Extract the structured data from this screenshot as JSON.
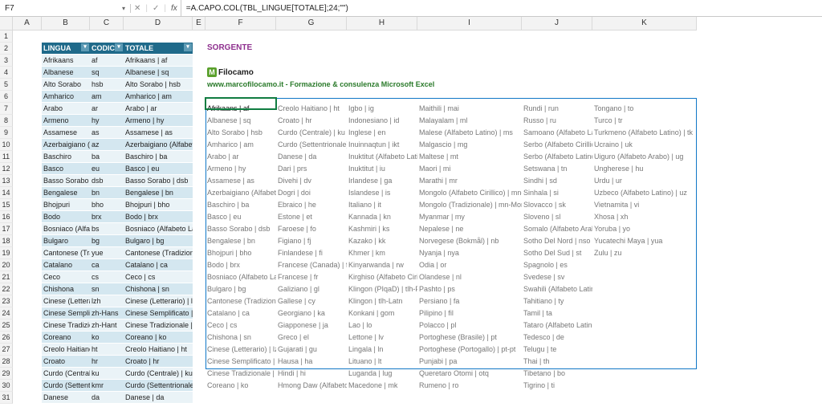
{
  "formula_bar": {
    "name_box": "F7",
    "formula": "=A.CAPO.COL(TBL_LINGUE[TOTALE];24;\"\")"
  },
  "columns": [
    "",
    "A",
    "B",
    "C",
    "D",
    "E",
    "F",
    "G",
    "H",
    "I",
    "J",
    "K"
  ],
  "rownums": [
    1,
    2,
    3,
    4,
    5,
    6,
    7,
    8,
    9,
    10,
    11,
    12,
    13,
    14,
    15,
    16,
    17,
    18,
    19,
    20,
    21,
    22,
    23,
    24,
    25,
    26,
    27,
    28,
    29,
    30,
    31
  ],
  "table": {
    "name": "TBL_LINGUE",
    "headers": {
      "lingua": "LINGUA",
      "codice": "CODICE",
      "totale": "TOTALE"
    },
    "rows": [
      {
        "l": "Afrikaans",
        "c": "af",
        "t": "Afrikaans | af"
      },
      {
        "l": "Albanese",
        "c": "sq",
        "t": "Albanese | sq"
      },
      {
        "l": "Alto Sorabo",
        "c": "hsb",
        "t": "Alto Sorabo | hsb"
      },
      {
        "l": "Amharico",
        "c": "am",
        "t": "Amharico | am"
      },
      {
        "l": "Arabo",
        "c": "ar",
        "t": "Arabo | ar"
      },
      {
        "l": "Armeno",
        "c": "hy",
        "t": "Armeno | hy"
      },
      {
        "l": "Assamese",
        "c": "as",
        "t": "Assamese | as"
      },
      {
        "l": "Azerbaigiano (Alfabeto Latino)",
        "c": "az",
        "t": "Azerbaigiano (Alfabeto Latino) | az"
      },
      {
        "l": "Baschiro",
        "c": "ba",
        "t": "Baschiro | ba"
      },
      {
        "l": "Basco",
        "c": "eu",
        "t": "Basco | eu"
      },
      {
        "l": "Basso Sorabo",
        "c": "dsb",
        "t": "Basso Sorabo | dsb"
      },
      {
        "l": "Bengalese",
        "c": "bn",
        "t": "Bengalese | bn"
      },
      {
        "l": "Bhojpuri",
        "c": "bho",
        "t": "Bhojpuri | bho"
      },
      {
        "l": "Bodo",
        "c": "brx",
        "t": "Bodo | brx"
      },
      {
        "l": "Bosniaco (Alfabeto Latino)",
        "c": "bs",
        "t": "Bosniaco (Alfabeto Latino) | bs"
      },
      {
        "l": "Bulgaro",
        "c": "bg",
        "t": "Bulgaro | bg"
      },
      {
        "l": "Cantonese (Tradizionale)",
        "c": "yue",
        "t": "Cantonese (Tradizionale) | yue"
      },
      {
        "l": "Catalano",
        "c": "ca",
        "t": "Catalano | ca"
      },
      {
        "l": "Ceco",
        "c": "cs",
        "t": "Ceco | cs"
      },
      {
        "l": "Chishona",
        "c": "sn",
        "t": "Chishona | sn"
      },
      {
        "l": "Cinese (Letterario)",
        "c": "lzh",
        "t": "Cinese (Letterario) | lzh"
      },
      {
        "l": "Cinese Semplificato",
        "c": "zh-Hans",
        "t": "Cinese Semplificato | zh-Hans"
      },
      {
        "l": "Cinese Tradizionale",
        "c": "zh-Hant",
        "t": "Cinese Tradizionale | zh-Hant"
      },
      {
        "l": "Coreano",
        "c": "ko",
        "t": "Coreano | ko"
      },
      {
        "l": "Creolo Haitiano",
        "c": "ht",
        "t": "Creolo Haitiano | ht"
      },
      {
        "l": "Croato",
        "c": "hr",
        "t": "Croato | hr"
      },
      {
        "l": "Curdo (Centrale)",
        "c": "ku",
        "t": "Curdo (Centrale) | ku"
      },
      {
        "l": "Curdo (Settentrionale)",
        "c": "kmr",
        "t": "Curdo (Settentrionale) | kmr"
      },
      {
        "l": "Danese",
        "c": "da",
        "t": "Danese | da"
      }
    ]
  },
  "right_panel": {
    "sorgente": "SORGENTE",
    "brand": "Filocamo",
    "tagline": "www.marcofilocamo.it - Formazione & consulenza Microsoft Excel"
  },
  "spill": [
    [
      "Afrikaans | af",
      "Creolo Haitiano | ht",
      "Igbo | ig",
      "Maithili | mai",
      "Rundi | run",
      "Tongano | to"
    ],
    [
      "Albanese | sq",
      "Croato | hr",
      "Indonesiano | id",
      "Malayalam | ml",
      "Russo | ru",
      "Turco | tr"
    ],
    [
      "Alto Sorabo | hsb",
      "Curdo (Centrale) | ku",
      "Inglese | en",
      "Malese (Alfabeto Latino) | ms",
      "Samoano (Alfabeto Latino) | sm",
      "Turkmeno (Alfabeto Latino) | tk"
    ],
    [
      "Amharico | am",
      "Curdo (Settentrionale) | kmr",
      "Inuinnaqtun | ikt",
      "Malgascio | mg",
      "Serbo (Alfabeto Cirillico) | sr-Cyrl",
      "Ucraino | uk"
    ],
    [
      "Arabo | ar",
      "Danese | da",
      "Inuktitut (Alfabeto Latino) | iu-Latn",
      "Maltese | mt",
      "Serbo (Alfabeto Latino) | sr-Latn",
      "Uiguro (Alfabeto Arabo) | ug"
    ],
    [
      "Armeno | hy",
      "Dari | prs",
      "Inuktitut | iu",
      "Maori | mi",
      "Setswana | tn",
      "Ungherese | hu"
    ],
    [
      "Assamese | as",
      "Divehi | dv",
      "Irlandese | ga",
      "Marathi | mr",
      "Sindhi | sd",
      "Urdu | ur"
    ],
    [
      "Azerbaigiano (Alfabeto Latino) | az",
      "Dogri | doi",
      "Islandese | is",
      "Mongolo (Alfabeto Cirillico) | mn-Cyrl",
      "Sinhala | si",
      "Uzbeco (Alfabeto Latino) | uz"
    ],
    [
      "Baschiro | ba",
      "Ebraico | he",
      "Italiano | it",
      "Mongolo (Tradizionale) | mn-Mong",
      "Slovacco | sk",
      "Vietnamita | vi"
    ],
    [
      "Basco | eu",
      "Estone | et",
      "Kannada | kn",
      "Myanmar | my",
      "Sloveno | sl",
      "Xhosa | xh"
    ],
    [
      "Basso Sorabo | dsb",
      "Faroese | fo",
      "Kashmiri | ks",
      "Nepalese | ne",
      "Somalo (Alfabeto Arabo) | so",
      "Yoruba | yo"
    ],
    [
      "Bengalese | bn",
      "Figiano | fj",
      "Kazako | kk",
      "Norvegese (Bokmål) | nb",
      "Sotho Del Nord | nso",
      "Yucatechi Maya | yua"
    ],
    [
      "Bhojpuri | bho",
      "Finlandese | fi",
      "Khmer | km",
      "Nyanja | nya",
      "Sotho Del Sud | st",
      "Zulu | zu"
    ],
    [
      "Bodo | brx",
      "Francese (Canada) | fr-ca",
      "Kinyarwanda | rw",
      "Odia | or",
      "Spagnolo | es",
      ""
    ],
    [
      "Bosniaco (Alfabeto Latino) | bs",
      "Francese | fr",
      "Kirghiso (Alfabeto Cirillico) | ky",
      "Olandese | nl",
      "Svedese | sv",
      ""
    ],
    [
      "Bulgaro | bg",
      "Galiziano | gl",
      "Klingon (PIqaD) | tlh-Piqd",
      "Pashto | ps",
      "Swahili (Alfabeto Latino) | sw",
      ""
    ],
    [
      "Cantonese (Tradizionale) | yue",
      "Gallese | cy",
      "Klingon | tlh-Latn",
      "Persiano | fa",
      "Tahitiano | ty",
      ""
    ],
    [
      "Catalano | ca",
      "Georgiano | ka",
      "Konkani | gom",
      "Pilipino | fil",
      "Tamil | ta",
      ""
    ],
    [
      "Ceco | cs",
      "Giapponese | ja",
      "Lao | lo",
      "Polacco | pl",
      "Tataro (Alfabeto Latino) | tt",
      ""
    ],
    [
      "Chishona | sn",
      "Greco | el",
      "Lettone | lv",
      "Portoghese (Brasile) | pt",
      "Tedesco | de",
      ""
    ],
    [
      "Cinese (Letterario) | lzh",
      "Gujarati | gu",
      "Lingala | ln",
      "Portoghese (Portogallo) | pt-pt",
      "Telugu | te",
      ""
    ],
    [
      "Cinese Semplificato | zh-Hans",
      "Hausa | ha",
      "Lituano | lt",
      "Punjabi | pa",
      "Thai | th",
      ""
    ],
    [
      "Cinese Tradizionale | zh-Hant",
      "Hindi | hi",
      "Luganda | lug",
      "Queretaro Otomi | otq",
      "Tibetano | bo",
      ""
    ],
    [
      "Coreano | ko",
      "Hmong Daw (Alfabeto Latino)",
      "Macedone | mk",
      "Rumeno | ro",
      "Tigrino | ti",
      ""
    ]
  ]
}
